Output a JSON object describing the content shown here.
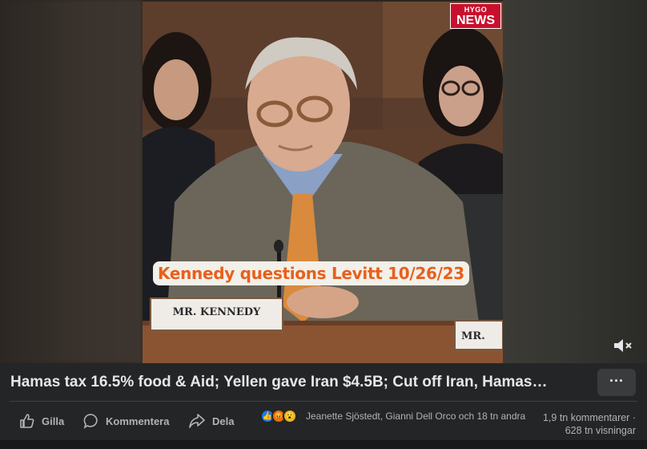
{
  "video": {
    "logo_top": "HYGO",
    "logo_bottom": "NEWS",
    "caption": "Kennedy questions Levitt 10/26/23",
    "nameplate_main": "MR. KENNEDY",
    "nameplate_side": "MR."
  },
  "post": {
    "title": "Hamas tax 16.5% food & Aid; Yellen gave Iran $4.5B; Cut off Iran, Hamas…",
    "more_label": "···"
  },
  "actions": {
    "like_label": "Gilla",
    "comment_label": "Kommentera",
    "share_label": "Dela"
  },
  "reactions": {
    "names": "Jeanette Sjöstedt, Gianni Dell Orco och 18 tn andra",
    "comments": "1,9 tn kommentarer",
    "views": "628 tn visningar",
    "colors": {
      "like": "#1877f2",
      "angry": "#e9710f",
      "wow": "#f7b125"
    }
  }
}
